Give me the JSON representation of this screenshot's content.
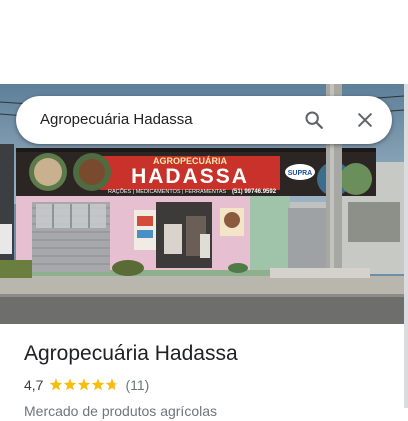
{
  "search": {
    "query": "Agropecuária Hadassa"
  },
  "photo": {
    "sign": {
      "top_label": "AGROPECUÁRIA",
      "name": "HADASSA",
      "services": "RAÇÕES | MEDICAMENTOS | FERRAMENTAS",
      "phone": "(51) 99746.9592",
      "brand": "SUPRA"
    }
  },
  "place": {
    "name": "Agropecuária Hadassa",
    "rating": "4,7",
    "stars": 4.7,
    "review_count": "(11)",
    "category": "Mercado de produtos agrícolas"
  },
  "colors": {
    "star": "#fbbc04",
    "wall_pink": "#e6bfd0",
    "sign_dark": "#2b2624",
    "sign_red": "#c8322a"
  },
  "icons": {
    "search": "search-icon",
    "close": "close-icon"
  }
}
